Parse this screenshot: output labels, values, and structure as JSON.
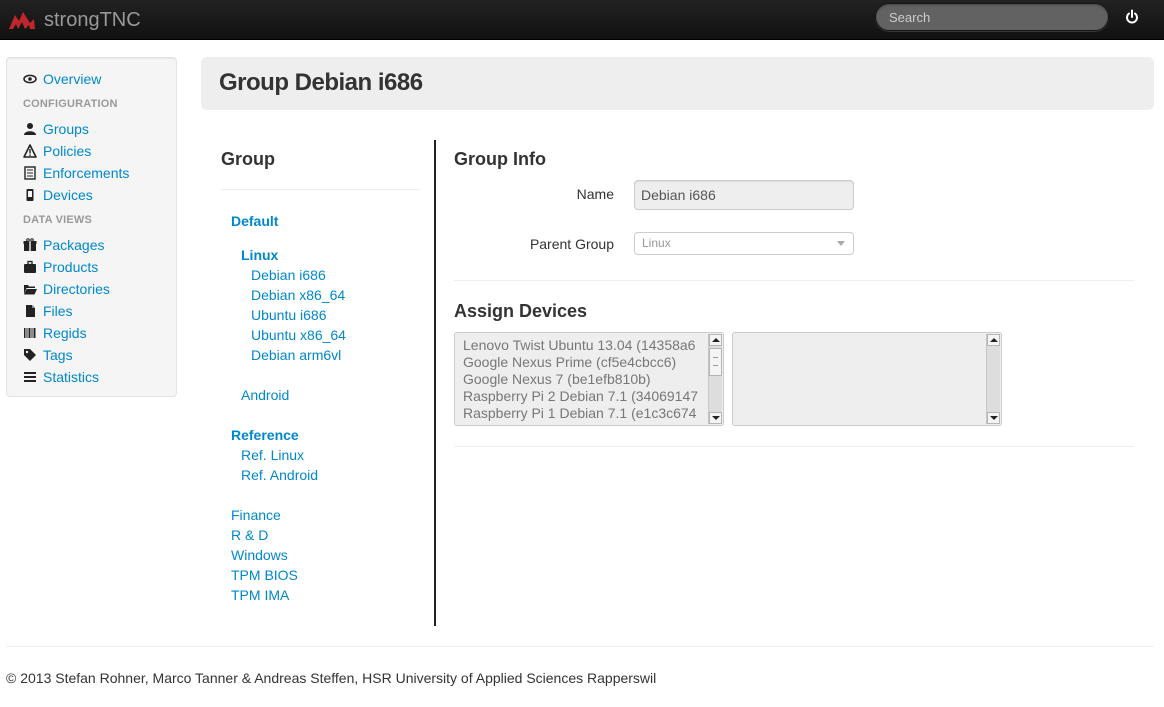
{
  "app": {
    "brand": "strongTNC"
  },
  "navbar": {
    "search_placeholder": "Search",
    "logout_icon": "power-icon"
  },
  "sidebar": {
    "overview": "Overview",
    "configuration_header": "CONFIGURATION",
    "configuration": [
      "Groups",
      "Policies",
      "Enforcements",
      "Devices"
    ],
    "data_views_header": "DATA VIEWS",
    "data_views": [
      "Packages",
      "Products",
      "Directories",
      "Files",
      "Regids",
      "Tags",
      "Statistics"
    ]
  },
  "page": {
    "title": "Group Debian i686"
  },
  "group_tree": {
    "title": "Group",
    "default": "Default",
    "linux": "Linux",
    "linux_children": [
      "Debian i686",
      "Debian x86_64",
      "Ubuntu i686",
      "Ubuntu x86_64",
      "Debian arm6vl"
    ],
    "android": "Android",
    "reference": "Reference",
    "reference_children": [
      "Ref. Linux",
      "Ref. Android"
    ],
    "others": [
      "Finance",
      "R & D",
      "Windows",
      "TPM BIOS",
      "TPM IMA"
    ]
  },
  "group_info": {
    "title": "Group Info",
    "name_label": "Name",
    "name_value": "Debian i686",
    "parent_label": "Parent Group",
    "parent_value": "Linux"
  },
  "assign_devices": {
    "title": "Assign Devices",
    "available": [
      "Lenovo Twist Ubuntu 13.04 (14358a6",
      "Google Nexus Prime (cf5e4cbcc6)",
      "Google Nexus 7 (be1efb810b)",
      "Raspberry Pi 2 Debian 7.1 (34069147",
      "Raspberry Pi 1 Debian 7.1 (e1c3c674"
    ],
    "assigned": []
  },
  "footer": {
    "text": "© 2013 Stefan Rohner, Marco Tanner & Andreas Steffen, HSR University of Applied Sciences Rapperswil"
  },
  "colors": {
    "link": "#0088cc",
    "navbar": "#1b1b1b",
    "brand_logo": "#c0272d"
  }
}
